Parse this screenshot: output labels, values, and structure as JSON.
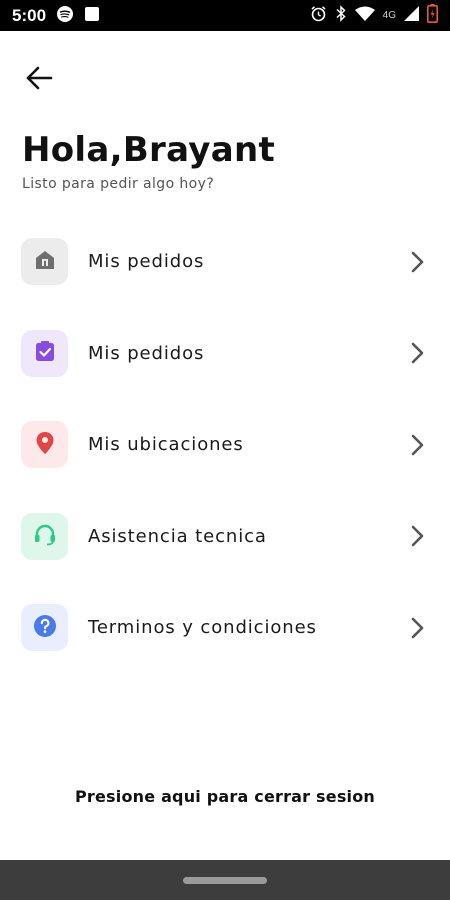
{
  "status_bar": {
    "time": "5:00",
    "network": "4G",
    "icons": [
      "spotify-icon",
      "notification-square-icon",
      "alarm-icon",
      "bluetooth-icon",
      "wifi-icon",
      "signal-icon",
      "battery-icon"
    ]
  },
  "header": {
    "back_icon": "arrow-left-icon",
    "greeting": "Hola,Brayant",
    "subtitle": "Listo para pedir algo hoy?"
  },
  "menu": {
    "items": [
      {
        "label": "Mis pedidos",
        "icon": "store-icon",
        "icon_bg": "#ececec",
        "icon_color": "#6f6f6f"
      },
      {
        "label": "Mis pedidos",
        "icon": "clipboard-check-icon",
        "icon_bg": "#efe8fb",
        "icon_color": "#8a4be0"
      },
      {
        "label": "Mis ubicaciones",
        "icon": "location-pin-icon",
        "icon_bg": "#fde9e9",
        "icon_color": "#e04848"
      },
      {
        "label": "Asistencia tecnica",
        "icon": "headset-icon",
        "icon_bg": "#dff7ea",
        "icon_color": "#2fc98a"
      },
      {
        "label": "Terminos y condiciones",
        "icon": "help-circle-icon",
        "icon_bg": "#e8eefd",
        "icon_color": "#4a79ea"
      }
    ],
    "chevron_icon": "chevron-right-icon",
    "chevron_color": "#555555"
  },
  "footer": {
    "logout_text": "Presione aqui para cerrar sesion"
  }
}
